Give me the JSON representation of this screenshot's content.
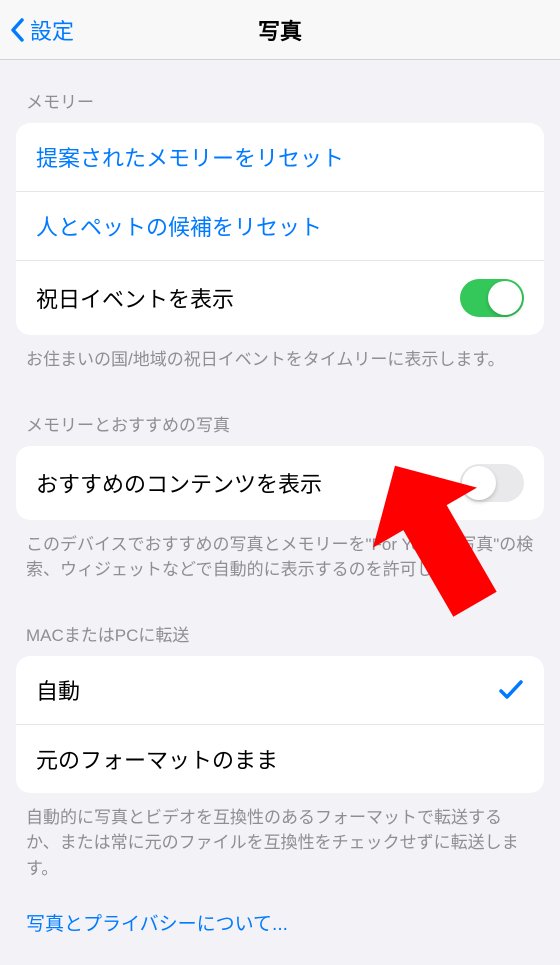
{
  "nav": {
    "back_label": "設定",
    "title": "写真"
  },
  "sections": {
    "memory": {
      "header": "メモリー",
      "reset_memories": "提案されたメモリーをリセット",
      "reset_people": "人とペットの候補をリセット",
      "show_holidays": "祝日イベントを表示",
      "holidays_on": true,
      "footer": "お住まいの国/地域の祝日イベントをタイムリーに表示します。"
    },
    "recommended": {
      "header": "メモリーとおすすめの写真",
      "show_recommended": "おすすめのコンテンツを表示",
      "recommended_on": false,
      "footer": "このデバイスでおすすめの写真とメモリーを\"For You\"、\"写真\"の検索、ウィジェットなどで自動的に表示するのを許可します。"
    },
    "transfer": {
      "header": "MACまたはPCに転送",
      "auto": "自動",
      "auto_selected": true,
      "original": "元のフォーマットのまま",
      "footer": "自動的に写真とビデオを互換性のあるフォーマットで転送するか、または常に元のファイルを互換性をチェックせずに転送します。"
    },
    "privacy_link": "写真とプライバシーについて..."
  },
  "colors": {
    "link": "#007aff",
    "toggle_on": "#34c759",
    "arrow": "#ff0000"
  },
  "annotations": {
    "arrow_target": "recommended-toggle"
  }
}
